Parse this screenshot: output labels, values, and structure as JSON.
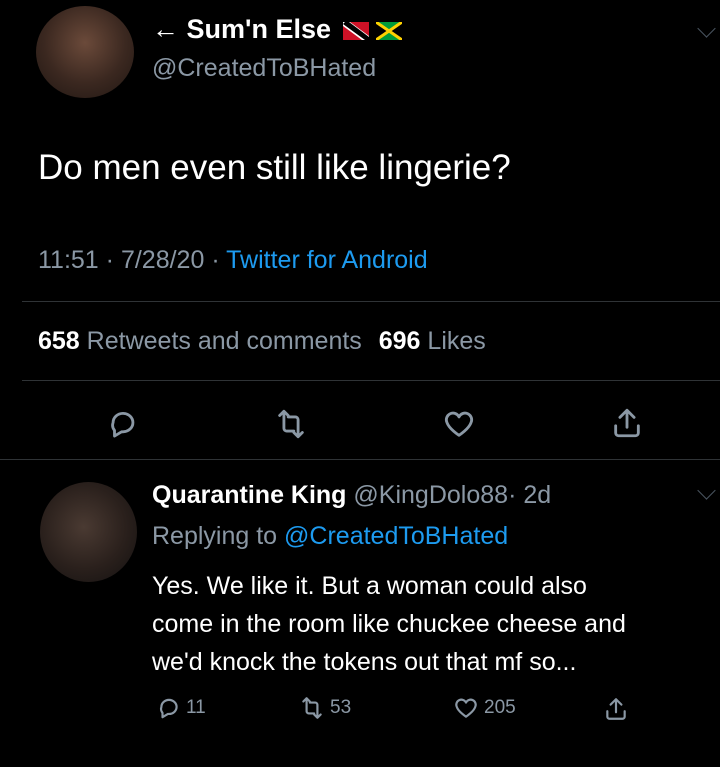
{
  "main_tweet": {
    "display_name": "Sum'n Else",
    "back_arrow": "←",
    "handle": "@CreatedToBHated",
    "text": "Do men even still like lingerie?",
    "time": "11:51",
    "date": "7/28/20",
    "separator": "·",
    "client": "Twitter for Android",
    "retweets_count": "658",
    "retweets_label": "Retweets and comments",
    "likes_count": "696",
    "likes_label": "Likes",
    "flags": [
      "trinidad-and-tobago-flag-icon",
      "jamaica-flag-icon"
    ]
  },
  "reply": {
    "display_name": "Quarantine King",
    "handle": "@KingDolo88",
    "separator": "·",
    "age": "2d",
    "replying_prefix": "Replying to",
    "replying_to": "@CreatedToBHated",
    "text_lines": [
      "Yes. We like it. But a woman could also",
      "come in the room like chuckee cheese and",
      "we'd knock the tokens out that mf so..."
    ],
    "reply_count": "11",
    "retweet_count": "53",
    "like_count": "205"
  },
  "colors": {
    "background": "#000000",
    "text": "#e7e9ea",
    "muted": "#8b98a5",
    "link": "#1d9bf0",
    "divider": "#2f3336"
  }
}
